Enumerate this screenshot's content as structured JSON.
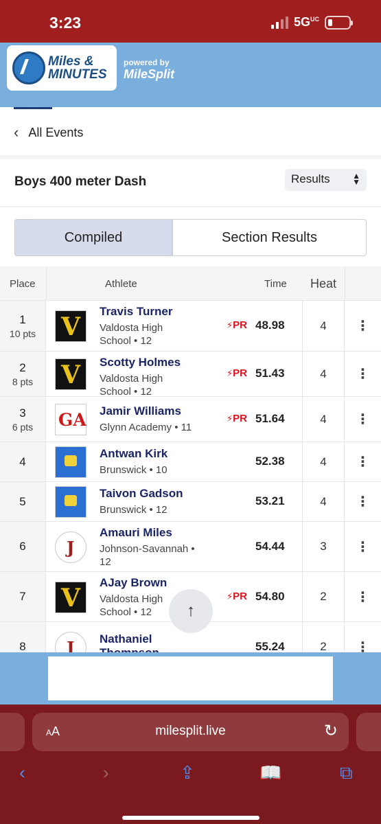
{
  "status_bar": {
    "time": "3:23",
    "network": "5G",
    "network_sup": "UC",
    "battery_level": 0.22
  },
  "brand": {
    "logo_text_line1": "Miles &",
    "logo_text_line2": "MINUTES",
    "powered_by": "powered by",
    "partner": "MileSplit"
  },
  "nav": {
    "back_label": "All Events"
  },
  "event": {
    "title": "Boys 400 meter Dash",
    "view_select": "Results"
  },
  "tabs": [
    {
      "label": "Compiled",
      "active": true
    },
    {
      "label": "Section Results",
      "active": false
    }
  ],
  "table": {
    "headers": {
      "place": "Place",
      "athlete": "Athlete",
      "time": "Time",
      "heat": "Heat"
    },
    "pr_label": "PR",
    "rows": [
      {
        "place": "1",
        "pts": "10 pts",
        "name": "Travis Turner",
        "school_line1": "Valdosta High",
        "school_line2": "School • 12",
        "pr": true,
        "time": "48.98",
        "heat": "4",
        "logo": "valdosta"
      },
      {
        "place": "2",
        "pts": "8 pts",
        "name": "Scotty Holmes",
        "school_line1": "Valdosta High",
        "school_line2": "School • 12",
        "pr": true,
        "time": "51.43",
        "heat": "4",
        "logo": "valdosta"
      },
      {
        "place": "3",
        "pts": "6 pts",
        "name": "Jamir Williams",
        "school_line1": "Glynn Academy • 11",
        "school_line2": "",
        "pr": true,
        "time": "51.64",
        "heat": "4",
        "logo": "glynn"
      },
      {
        "place": "4",
        "pts": "",
        "name": "Antwan Kirk",
        "school_line1": "Brunswick • 10",
        "school_line2": "",
        "pr": false,
        "time": "52.38",
        "heat": "4",
        "logo": "brunswick"
      },
      {
        "place": "5",
        "pts": "",
        "name": "Taivon Gadson",
        "school_line1": "Brunswick • 12",
        "school_line2": "",
        "pr": false,
        "time": "53.21",
        "heat": "4",
        "logo": "brunswick"
      },
      {
        "place": "6",
        "pts": "",
        "name": "Amauri Miles",
        "school_line1": "Johnson-Savannah •",
        "school_line2": "12",
        "pr": false,
        "time": "54.44",
        "heat": "3",
        "logo": "johnson"
      },
      {
        "place": "7",
        "pts": "",
        "name": "AJay Brown",
        "school_line1": "Valdosta High",
        "school_line2": "School • 12",
        "pr": true,
        "time": "54.80",
        "heat": "2",
        "logo": "valdosta"
      },
      {
        "place": "8",
        "pts": "",
        "name": "Nathaniel",
        "name_line2": "Thompson",
        "school_line1": "",
        "school_line2": "",
        "pr": false,
        "time": "55.24",
        "heat": "2",
        "logo": "johnson"
      }
    ]
  },
  "browser": {
    "text_size_label": "AA",
    "url": "milesplit.live"
  }
}
